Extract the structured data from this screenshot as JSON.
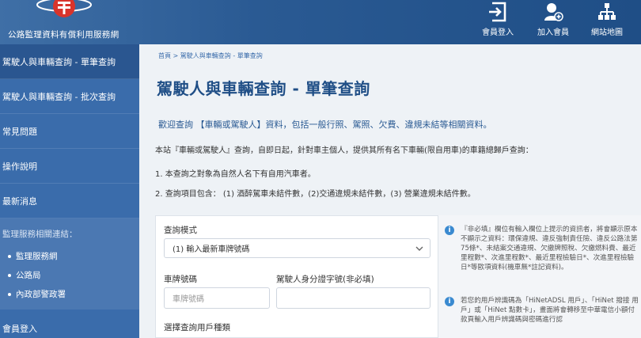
{
  "header": {
    "site_name": "公路監理資料有償利用服務網",
    "nav": [
      {
        "label": "會員登入",
        "icon": "login-icon"
      },
      {
        "label": "加入會員",
        "icon": "add-user-icon"
      },
      {
        "label": "網站地圖",
        "icon": "sitemap-icon"
      }
    ]
  },
  "sidebar": {
    "items": [
      {
        "label": "駕駛人與車輛查詢 - 單筆查詢"
      },
      {
        "label": "駕駛人與車輛查詢 - 批次查詢"
      },
      {
        "label": "常見問題"
      },
      {
        "label": "操作說明"
      },
      {
        "label": "最新消息"
      }
    ],
    "section_title": "監理服務相關連結：",
    "links": [
      "監理服務網",
      "公路局",
      "內政部警政署"
    ],
    "bottom_item": "會員登入"
  },
  "main": {
    "breadcrumb": "首頁 > 駕駛人與車輛查詢 - 單筆查詢",
    "title": "駕駛人與車輛查詢 - 單筆查詢",
    "welcome": "歡迎查詢 【車輛或駕駛人】資料，包括一般行照、駕照、欠費、違規未結等相關資料。",
    "p1": "本站『車輛或駕駛人』查詢，自即日起，針對車主個人，提供其所有名下車輛(限自用車)的車籍總歸戶查詢：",
    "p2": "1. 本查詢之對象為自然人名下有自用汽車者。",
    "p3": "2. 查詢項目包含： (1) 酒醉駕車未結件數，(2)交通違規未結件數，(3) 營業違規未結件數。"
  },
  "form": {
    "mode_label": "查詢模式",
    "mode_value": "(1) 輸入最新車牌號碼",
    "plate_label": "車牌號碼",
    "plate_placeholder": "車牌號碼",
    "id_label": "駕駛人身分證字號(非必填)",
    "id_value": "",
    "user_type_label": "選擇查詢用戶種類"
  },
  "info": {
    "note1": "『非必填』欄位有輸入欄位上提示的資訊者，將會顯示原本不顯示之資料：環保違規、違反強制責任險、違反公路法第75條*、未結案交通違規、欠繳牌照稅、欠繳燃料費、最近里程數*、次進里程數*、最近里程檢驗日*、次進里程檢驗日*等歐項資料(機車無*註記資料)。",
    "note2": "若您的用戶辨識碼為「HiNetADSL 用戶」、「HiNet 撥接 用戶」或「HiNet 點數卡」，畫面將會轉移至中華電信小額付款頁輸入用戶辨識碼與密碼進行認"
  },
  "colors": {
    "header": "#2a5a93",
    "sidebar": "#3a6cab",
    "title": "#1f4e86",
    "info_icon": "#3a8ad0"
  }
}
